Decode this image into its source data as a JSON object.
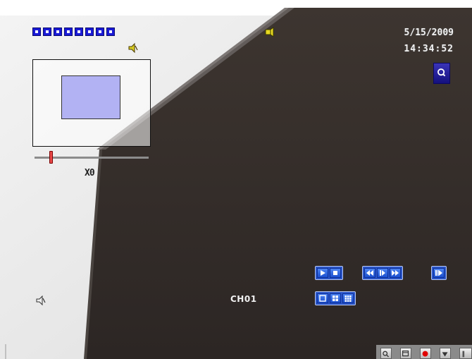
{
  "datetime": {
    "date": "5/15/2009",
    "time": "14:34:52"
  },
  "channel": {
    "label": "CH01"
  },
  "channel_strip": {
    "count": 8
  },
  "zoom": {
    "label": "X0",
    "level": 0.14
  },
  "icons": {
    "search": "search-icon",
    "speaker": "speaker-icon",
    "alarm": "alarm-icon"
  },
  "playback_controls": {
    "group1": [
      "play-icon",
      "stop-icon"
    ],
    "group2": [
      "rewind-icon",
      "step-forward-icon",
      "fast-forward-icon"
    ],
    "group3": [
      "slow-play-icon"
    ],
    "layout": [
      "single-view-icon",
      "quad-view-icon",
      "grid-view-icon"
    ]
  },
  "tray": {
    "items": [
      "search-icon",
      "window-icon",
      "record-icon",
      "menu-icon",
      "more-icon"
    ]
  },
  "colors": {
    "button_blue": "#1b4fcf",
    "search_button": "#14107e",
    "record_red": "#e00000"
  }
}
